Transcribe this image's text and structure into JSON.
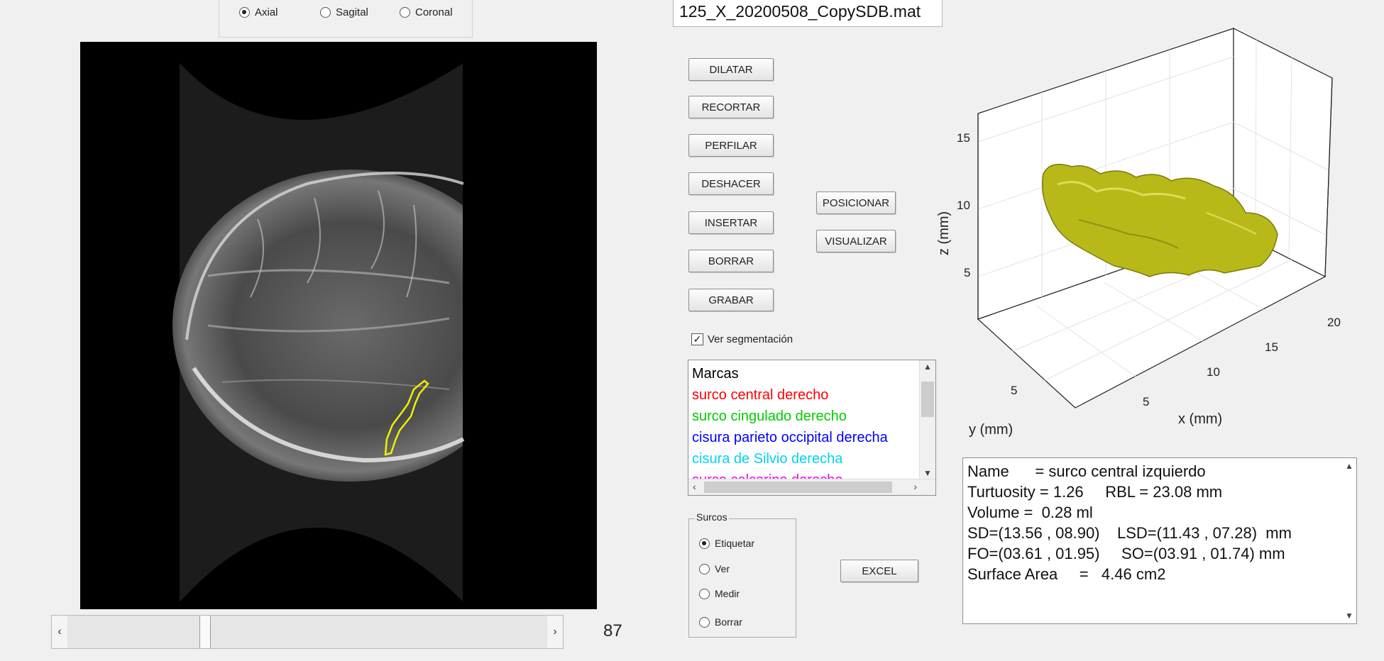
{
  "view": {
    "options": [
      {
        "label": "Axial",
        "selected": true
      },
      {
        "label": "Sagital",
        "selected": false
      },
      {
        "label": "Coronal",
        "selected": false
      }
    ]
  },
  "file": {
    "name": "125_X_20200508_CopySDB.mat"
  },
  "slice": {
    "number": "87",
    "slider_fraction": 0.28
  },
  "buttons": {
    "dilatar": "DILATAR",
    "recortar": "RECORTAR",
    "perfilar": "PERFILAR",
    "deshacer": "DESHACER",
    "insertar": "INSERTAR",
    "borrar": "BORRAR",
    "grabar": "GRABAR",
    "posicionar": "POSICIONAR",
    "visualizar": "VISUALIZAR",
    "excel": "EXCEL"
  },
  "segmentation": {
    "label": "Ver segmentación",
    "checked": true
  },
  "marks": {
    "items": [
      {
        "label": "Marcas",
        "color": "#000000"
      },
      {
        "label": "surco central derecho",
        "color": "#ff0000"
      },
      {
        "label": "surco cingulado derecho",
        "color": "#00cc00"
      },
      {
        "label": "cisura parieto occipital derecha",
        "color": "#0000ff"
      },
      {
        "label": "cisura de Silvio derecha",
        "color": "#00d5ea"
      },
      {
        "label": "surco calcarino derecho",
        "color": "#ee00ee"
      }
    ]
  },
  "surcos": {
    "title": "Surcos",
    "options": [
      {
        "label": "Etiquetar",
        "selected": true
      },
      {
        "label": "Ver",
        "selected": false
      },
      {
        "label": "Medir",
        "selected": false
      },
      {
        "label": "Borrar",
        "selected": false
      }
    ]
  },
  "plot": {
    "xlabel": "x (mm)",
    "ylabel": "y (mm)",
    "zlabel": "z (mm)",
    "z_ticks": [
      "15",
      "10",
      "5"
    ],
    "x_ticks": [
      "5",
      "10",
      "15",
      "20"
    ],
    "y_ticks": [
      "5"
    ],
    "surface_color": "#c8c81e"
  },
  "info": {
    "lines": [
      "Name      = surco central izquierdo",
      "Turtuosity = 1.26     RBL = 23.08 mm",
      "Volume =  0.28 ml",
      "SD=(13.56 , 08.90)    LSD=(11.43 , 07.28)  mm",
      "FO=(03.61 , 01.95)     SO=(03.91 , 01.74) mm",
      "Surface Area     =   4.46 cm2"
    ]
  }
}
